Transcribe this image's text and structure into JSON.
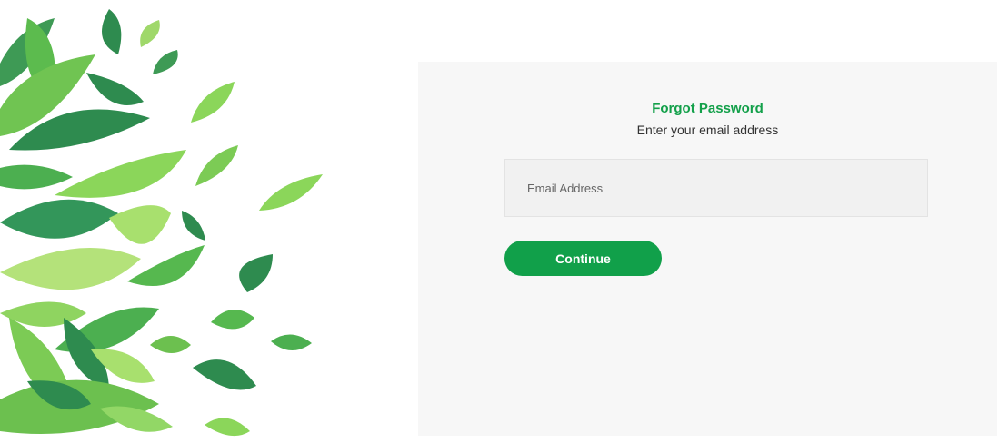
{
  "forgot": {
    "title": "Forgot Password",
    "subtitle": "Enter your email address",
    "email_placeholder": "Email Address",
    "continue_label": "Continue"
  },
  "colors": {
    "accent": "#11a04a",
    "card_background": "#f7f7f7",
    "leaf_dark": "#2e8b4f",
    "leaf_mid": "#4caf50",
    "leaf_light": "#8bd65a",
    "leaf_pale": "#b4e27a"
  },
  "decor": {
    "illustration": "green-leaves"
  }
}
